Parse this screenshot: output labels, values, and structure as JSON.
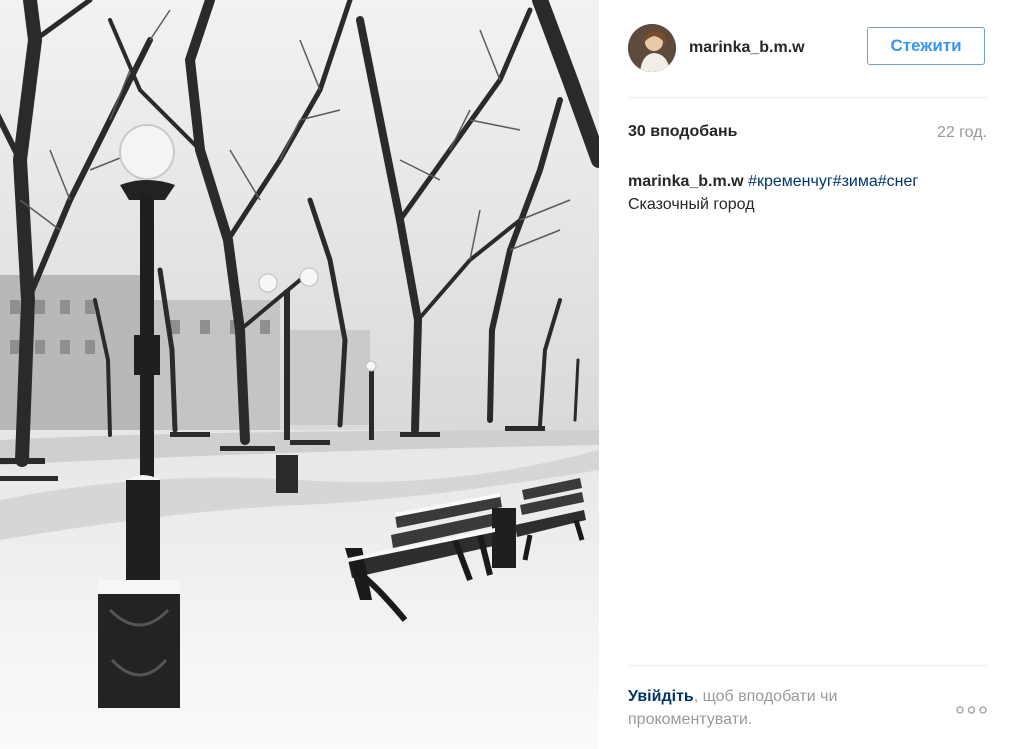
{
  "post": {
    "username": "marinka_b.m.w",
    "follow_label": "Стежити",
    "likes_text": "30 вподобань",
    "time_text": "22 год.",
    "caption": {
      "username": "marinka_b.m.w",
      "tags": [
        "#кременчуг",
        "#зима",
        "#снег"
      ],
      "text": "Сказочный город"
    },
    "login_link": "Увійдіть",
    "login_suffix": ", щоб вподобати чи прокоментувати.",
    "more_icon": "ellipsis-icon"
  },
  "photo": {
    "subject": "snowy park with benches and lamp posts",
    "palette": "grayscale"
  },
  "colors": {
    "follow_border": "#70a0c8",
    "follow_text": "#3897f0",
    "link_dark": "#003569",
    "text_primary": "#262626",
    "text_muted": "#999999"
  }
}
